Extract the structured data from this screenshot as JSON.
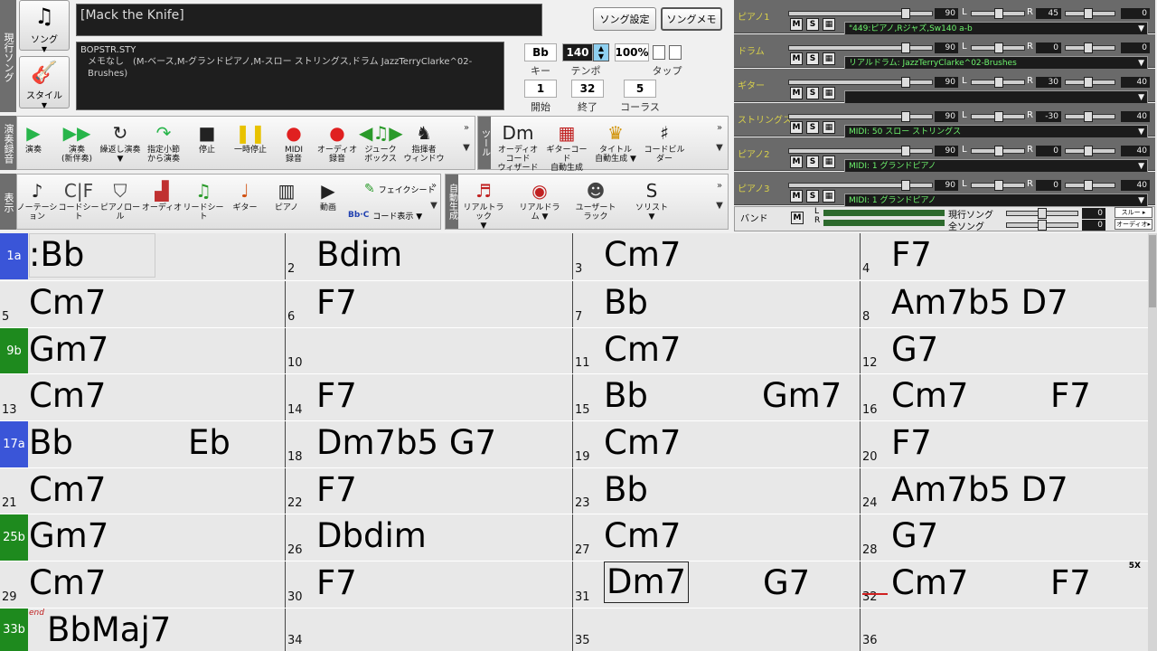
{
  "left_labels": {
    "current_song": "現行ソング",
    "play_record": "演奏録音",
    "display": "表示"
  },
  "song_button": {
    "label": "ソング",
    "icon": "music-notes-icon"
  },
  "style_button": {
    "label": "スタイル",
    "icon": "guitar-icon"
  },
  "song_title": "[Mack the Knife]",
  "style_info": {
    "file": "BOPSTR.STY",
    "memo": "メモなし　(M-ベース,M-グランドピアノ,M-スロー ストリングス,ドラム JazzTerryClarke^02-Brushes)"
  },
  "header_buttons": {
    "song_settings": "ソング設定",
    "song_memo": "ソングメモ"
  },
  "song_params": {
    "key": {
      "value": "Bb",
      "label": "キー"
    },
    "tempo": {
      "value": "140",
      "label": "テンポ"
    },
    "percent": {
      "value": "100%"
    },
    "tap": {
      "label": "タップ"
    },
    "start": {
      "value": "1",
      "label": "開始"
    },
    "end": {
      "value": "32",
      "label": "終了"
    },
    "chorus": {
      "value": "5",
      "label": "コーラス"
    }
  },
  "play_toolbar": [
    {
      "name": "play",
      "label": "演奏",
      "icon": "▶",
      "color": "#27b54a"
    },
    {
      "name": "play-new",
      "label": "演奏\n(新伴奏)",
      "icon": "▶▶",
      "color": "#27b54a"
    },
    {
      "name": "loop-play",
      "label": "繰返し演奏\n▼",
      "icon": "↻",
      "color": "#222"
    },
    {
      "name": "play-from-bar",
      "label": "指定小節\nから演奏",
      "icon": "↷",
      "color": "#27b54a"
    },
    {
      "name": "stop",
      "label": "停止",
      "icon": "■",
      "color": "#222"
    },
    {
      "name": "pause",
      "label": "一時停止",
      "icon": "❚❚",
      "color": "#e8c200"
    },
    {
      "name": "midi-record",
      "label": "MIDI\n録音",
      "icon": "●",
      "color": "#e02020"
    },
    {
      "name": "audio-record",
      "label": "オーディオ\n録音",
      "icon": "●",
      "color": "#e02020"
    },
    {
      "name": "jukebox",
      "label": "ジューク\nボックス",
      "icon": "◀♫▶",
      "color": "#2a9a2a"
    },
    {
      "name": "conductor",
      "label": "指揮者\nウィンドウ",
      "icon": "♞",
      "color": "#222"
    }
  ],
  "tools_label": "ツール",
  "tools_toolbar": [
    {
      "name": "audio-chord-wizard",
      "label": "オーディオコード\nウィザード",
      "icon": "Dm",
      "color": "#222"
    },
    {
      "name": "guitar-chord-auto",
      "label": "ギターコード\n自動生成",
      "icon": "▦",
      "color": "#c02020"
    },
    {
      "name": "title-auto",
      "label": "タイトル\n自動生成 ▼",
      "icon": "♛",
      "color": "#d09000"
    },
    {
      "name": "chord-builder",
      "label": "コードビルダー",
      "icon": "♯",
      "color": "#222"
    }
  ],
  "view_toolbar": [
    {
      "name": "notation",
      "label": "ノーテーション",
      "icon": "♪",
      "color": "#222"
    },
    {
      "name": "chord-sheet",
      "label": "コードシート",
      "icon": "C|F",
      "color": "#444"
    },
    {
      "name": "piano-roll",
      "label": "ピアノロール",
      "icon": "⛉",
      "color": "#444"
    },
    {
      "name": "audio",
      "label": "オーディオ",
      "icon": "▟",
      "color": "#c03030"
    },
    {
      "name": "lead-sheet",
      "label": "リードシート",
      "icon": "♫",
      "color": "#2a9a2a"
    },
    {
      "name": "guitar",
      "label": "ギター",
      "icon": "♩",
      "color": "#d05010"
    },
    {
      "name": "piano",
      "label": "ピアノ",
      "icon": "▥",
      "color": "#222"
    },
    {
      "name": "video",
      "label": "動画",
      "icon": "▶",
      "color": "#222"
    }
  ],
  "fake_sheet": "フェイクシート",
  "chord_display": "コード表示 ▼",
  "chord_display_icon": "Bb·C",
  "auto_label": "自動生成",
  "auto_toolbar": [
    {
      "name": "real-tracks",
      "label": "リアルトラック\n▼",
      "icon": "♬",
      "color": "#c02020"
    },
    {
      "name": "real-drums",
      "label": "リアルドラム ▼",
      "icon": "◉",
      "color": "#c02020"
    },
    {
      "name": "user-tracks",
      "label": "ユーザートラック",
      "icon": "☻",
      "color": "#444"
    },
    {
      "name": "soloist",
      "label": "ソリスト\n▼",
      "icon": "S",
      "color": "#222"
    }
  ],
  "mixer": [
    {
      "name": "ピアノ1",
      "vol": "90",
      "pan": "45",
      "rev": "0",
      "patch": "\"449:ピアノ,Rジャズ,Sw140 a-b"
    },
    {
      "name": "ドラム",
      "vol": "90",
      "pan": "0",
      "rev": "0",
      "patch": "リアルドラム: JazzTerryClarke^02-Brushes"
    },
    {
      "name": "ギター",
      "vol": "90",
      "pan": "30",
      "rev": "40",
      "patch": ""
    },
    {
      "name": "ストリングス",
      "vol": "90",
      "pan": "-30",
      "rev": "40",
      "patch": "MIDI: 50 スロー ストリングス"
    },
    {
      "name": "ピアノ2",
      "vol": "90",
      "pan": "0",
      "rev": "40",
      "patch": "MIDI: 1 グランドピアノ"
    },
    {
      "name": "ピアノ3",
      "vol": "90",
      "pan": "0",
      "rev": "40",
      "patch": "MIDI: 1 グランドピアノ"
    }
  ],
  "mixer_letters": {
    "m": "M",
    "s": "S",
    "l": "L",
    "r": "R"
  },
  "band": {
    "label": "バンド",
    "current_song": "現行ソング",
    "all_songs": "全ソング",
    "v1": "0",
    "v2": "0",
    "slew": "スルー ▸",
    "audio": "オーディオ▸"
  },
  "section_markers": {
    "1": "1a",
    "9": "9b",
    "17": "17a",
    "25": "25b",
    "33": "33b"
  },
  "marker_colors": {
    "a": "#3a55d8",
    "b": "#1e8a1e"
  },
  "bars": [
    {
      "n": "1",
      "chords": [
        ":Bb"
      ]
    },
    {
      "n": "2",
      "chords": [
        "Bdim"
      ]
    },
    {
      "n": "3",
      "chords": [
        "Cm7"
      ]
    },
    {
      "n": "4",
      "chords": [
        "F7"
      ]
    },
    {
      "n": "5",
      "chords": [
        "Cm7"
      ]
    },
    {
      "n": "6",
      "chords": [
        "F7"
      ]
    },
    {
      "n": "7",
      "chords": [
        "Bb"
      ]
    },
    {
      "n": "8",
      "chords": [
        "Am7b5 D7"
      ]
    },
    {
      "n": "9",
      "chords": [
        "Gm7"
      ]
    },
    {
      "n": "10",
      "chords": [
        ""
      ]
    },
    {
      "n": "11",
      "chords": [
        "Cm7"
      ]
    },
    {
      "n": "12",
      "chords": [
        "G7"
      ]
    },
    {
      "n": "13",
      "chords": [
        "Cm7"
      ]
    },
    {
      "n": "14",
      "chords": [
        "F7"
      ]
    },
    {
      "n": "15",
      "chords": [
        "Bb",
        "Gm7"
      ]
    },
    {
      "n": "16",
      "chords": [
        "Cm7",
        "F7"
      ]
    },
    {
      "n": "17",
      "chords": [
        "Bb",
        "Eb"
      ]
    },
    {
      "n": "18",
      "chords": [
        "Dm7b5 G7"
      ]
    },
    {
      "n": "19",
      "chords": [
        "Cm7"
      ]
    },
    {
      "n": "20",
      "chords": [
        "F7"
      ]
    },
    {
      "n": "21",
      "chords": [
        "Cm7"
      ]
    },
    {
      "n": "22",
      "chords": [
        "F7"
      ]
    },
    {
      "n": "23",
      "chords": [
        "Bb"
      ]
    },
    {
      "n": "24",
      "chords": [
        "Am7b5 D7"
      ]
    },
    {
      "n": "25",
      "chords": [
        "Gm7"
      ]
    },
    {
      "n": "26",
      "chords": [
        "Dbdim"
      ]
    },
    {
      "n": "27",
      "chords": [
        "Cm7"
      ]
    },
    {
      "n": "28",
      "chords": [
        "G7"
      ]
    },
    {
      "n": "29",
      "chords": [
        "Cm7"
      ]
    },
    {
      "n": "30",
      "chords": [
        "F7"
      ]
    },
    {
      "n": "31",
      "chords": [
        "Dm7",
        "G7"
      ]
    },
    {
      "n": "32",
      "chords": [
        "Cm7",
        "F7"
      ]
    },
    {
      "n": "33",
      "chords": [
        "BbMaj7"
      ]
    },
    {
      "n": "34",
      "chords": [
        ""
      ]
    },
    {
      "n": "35",
      "chords": [
        ""
      ]
    },
    {
      "n": "36",
      "chords": [
        ""
      ]
    }
  ],
  "end_tag": "end",
  "repeat_tag": "5X"
}
